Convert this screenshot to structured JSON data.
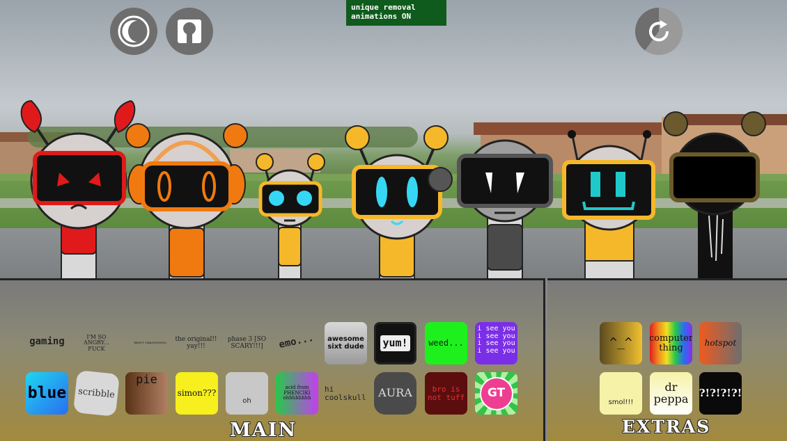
{
  "notice": {
    "line1": "unique removal",
    "line2": "animations ON"
  },
  "header": {
    "left_buttons": [
      {
        "icon": "moon-icon"
      },
      {
        "icon": "head-icon"
      }
    ],
    "right_button": {
      "icon": "reset-icon"
    }
  },
  "main_panel": {
    "title": "MAIN",
    "row1": [
      {
        "label": "gaming"
      },
      {
        "label": "I'M SO ANGRY... FUCK"
      },
      {
        "label": "ɪᴍɴᴏᴛ ʟᴍᴀᴏᴏᴏᴏᴏᴏᴏ"
      },
      {
        "label": "the original!! yay!!!"
      },
      {
        "label": "phase 3 [SO SCARY!!!]"
      },
      {
        "label": "emo..."
      },
      {
        "label": "awesome sixt dude"
      },
      {
        "label": "yum!"
      },
      {
        "label": "weed..."
      },
      {
        "label": "i see you i see you i see you i see you"
      }
    ],
    "row2": [
      {
        "label": "blue"
      },
      {
        "label": "scribble"
      },
      {
        "label": "pie"
      },
      {
        "label": "simon???"
      },
      {
        "label": "oh"
      },
      {
        "label": "acid from PHENCIKI ohhhhhhhh"
      },
      {
        "label": "hi coolskull"
      },
      {
        "label": "AURA"
      },
      {
        "label": "bro is not tuff"
      },
      {
        "label": "GT"
      }
    ]
  },
  "extras_panel": {
    "title": "EXTRAS",
    "row1": [
      {
        "label": "^_^"
      },
      {
        "label": "computer thing"
      },
      {
        "label": "hotspot"
      }
    ],
    "row2": [
      {
        "label": "smol!!!"
      },
      {
        "label": "dr peppa"
      },
      {
        "label": "?!?!?!?!"
      }
    ]
  },
  "colors": {
    "accent_green": "#0f5b1d",
    "panel_border": "#222222"
  }
}
